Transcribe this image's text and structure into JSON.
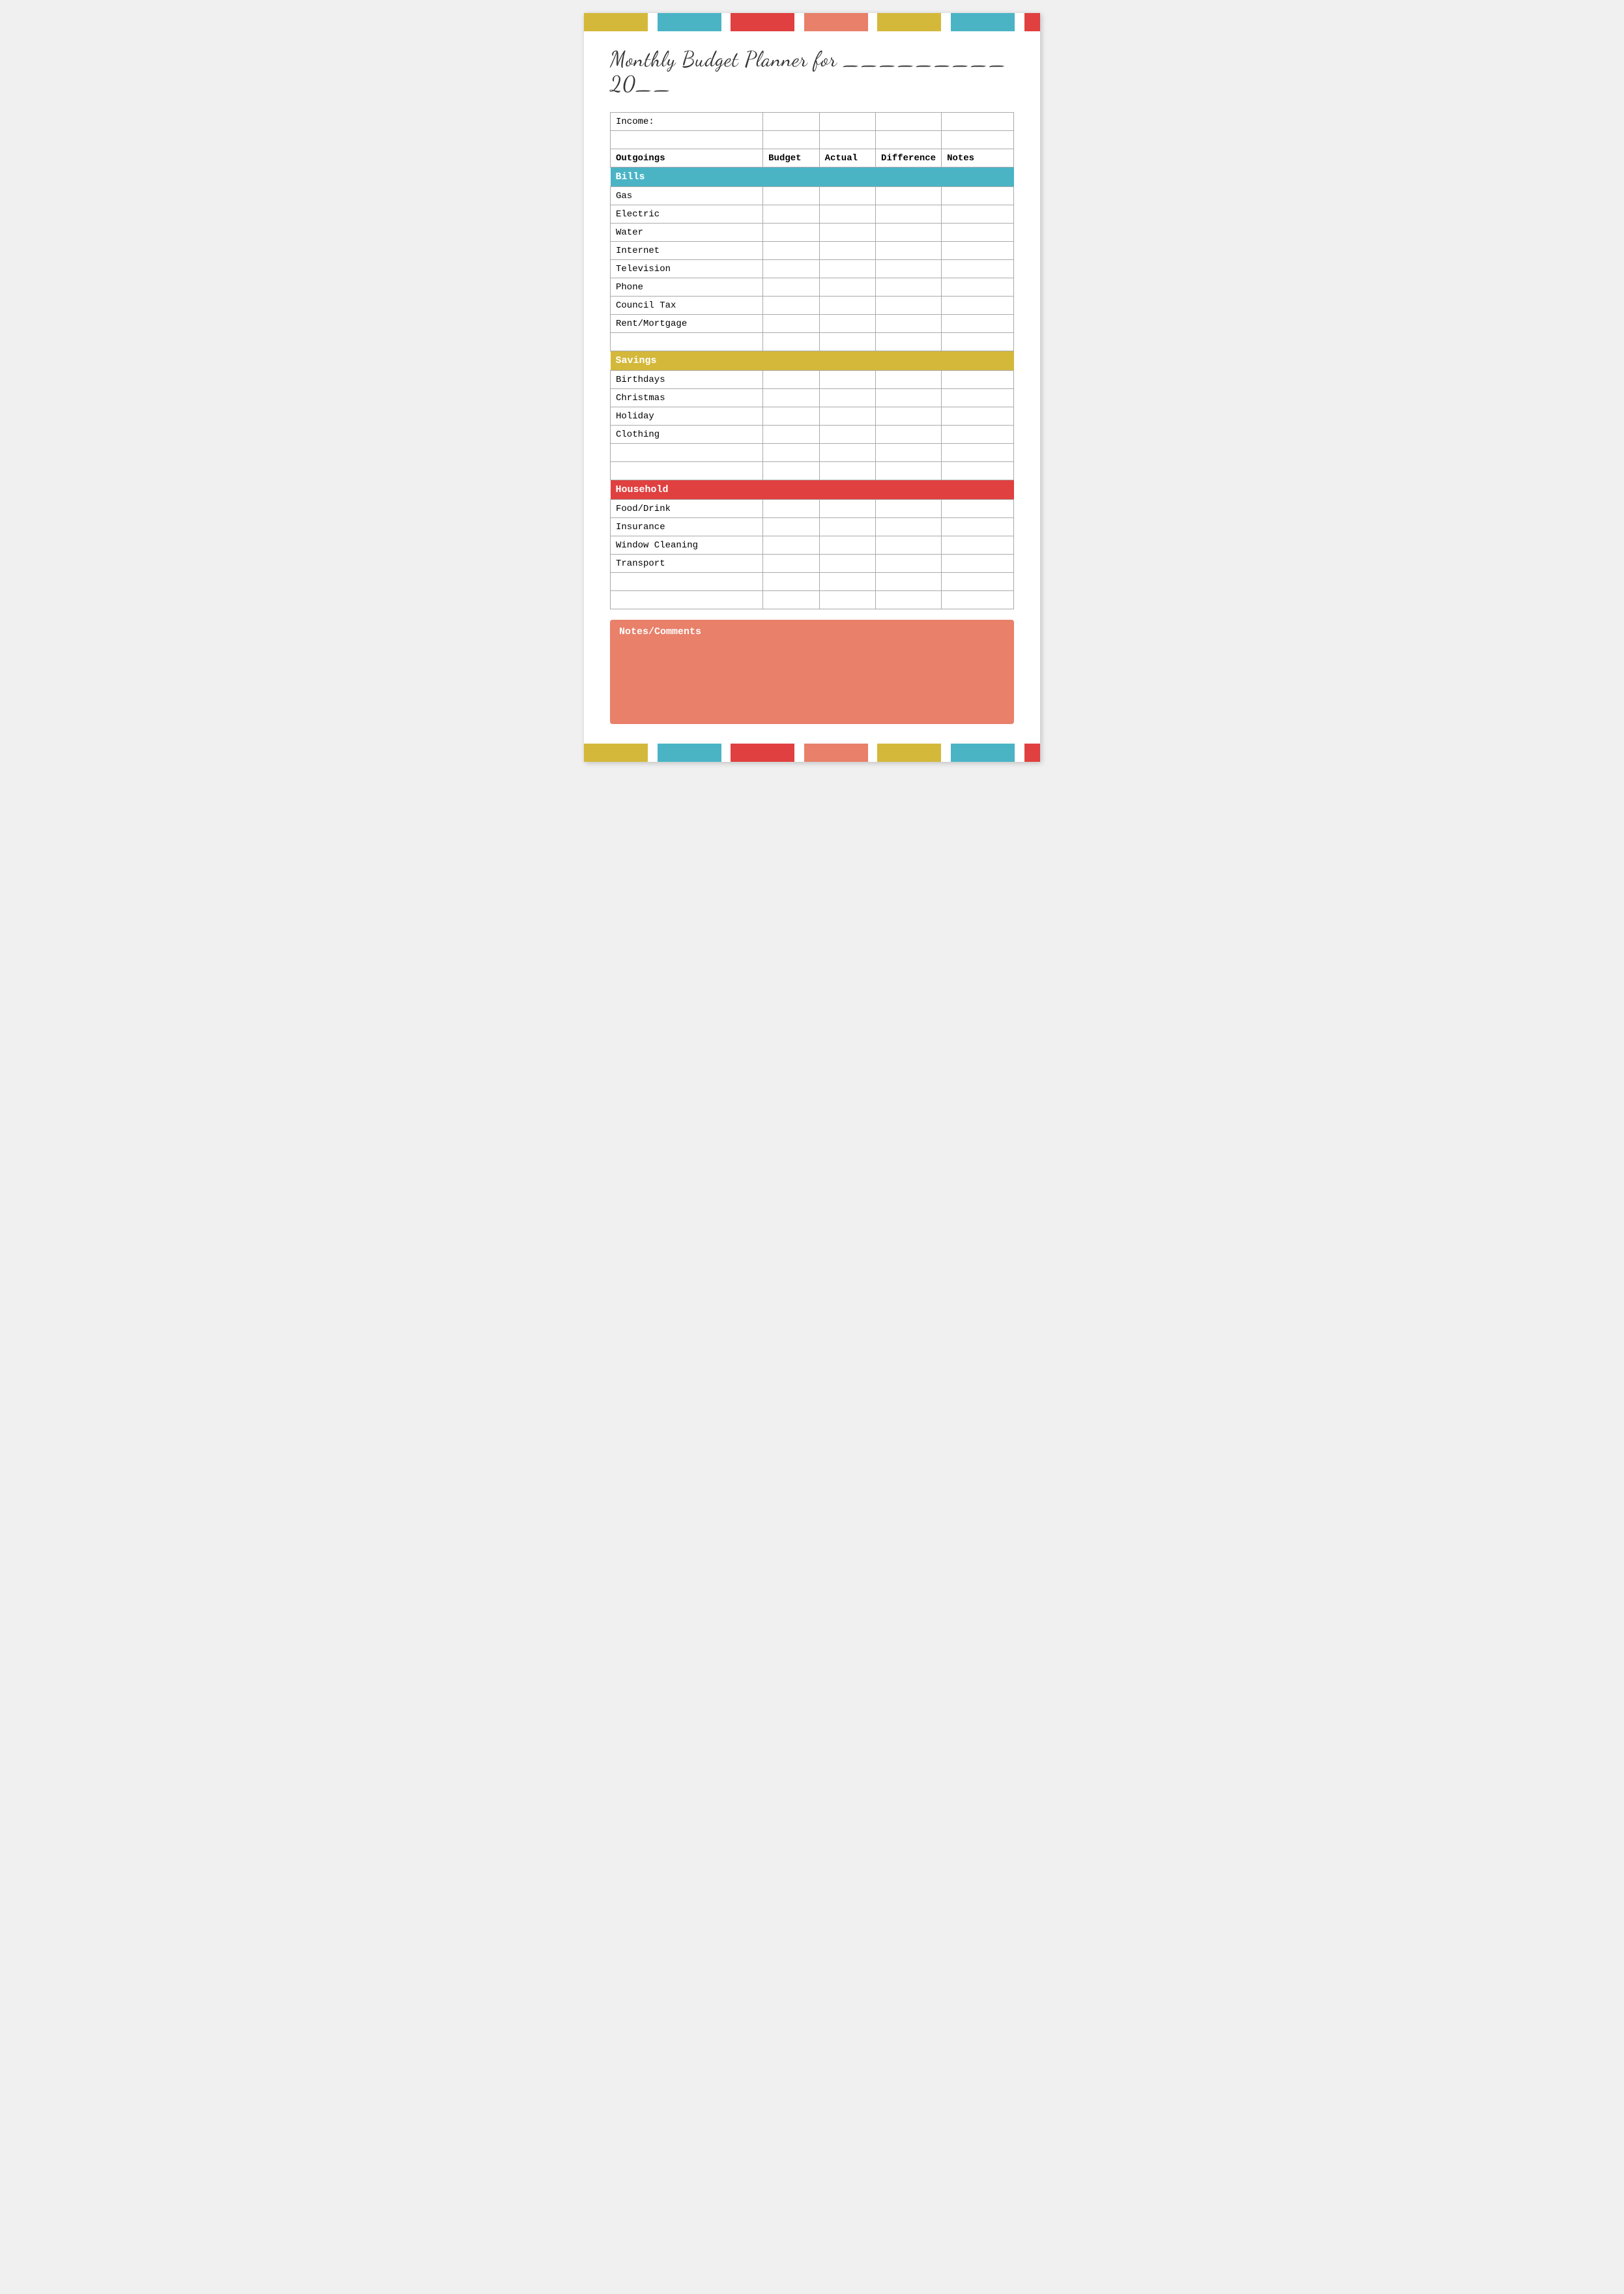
{
  "topBar": {
    "segments": [
      {
        "color": "#d4b83a",
        "flex": 2
      },
      {
        "color": "#ffffff",
        "flex": 0.3
      },
      {
        "color": "#4ab4c5",
        "flex": 2
      },
      {
        "color": "#ffffff",
        "flex": 0.3
      },
      {
        "color": "#e04040",
        "flex": 2
      },
      {
        "color": "#ffffff",
        "flex": 0.3
      },
      {
        "color": "#e8806a",
        "flex": 2
      },
      {
        "color": "#ffffff",
        "flex": 0.3
      },
      {
        "color": "#d4b83a",
        "flex": 2
      },
      {
        "color": "#ffffff",
        "flex": 0.3
      },
      {
        "color": "#4ab4c5",
        "flex": 2
      },
      {
        "color": "#ffffff",
        "flex": 0.3
      },
      {
        "color": "#e04040",
        "flex": 0.5
      }
    ]
  },
  "title": "Monthly Budget Planner for _________ 20__",
  "table": {
    "income_label": "Income:",
    "headers": {
      "outgoings": "Outgoings",
      "budget": "Budget",
      "actual": "Actual",
      "difference": "Difference",
      "notes": "Notes"
    },
    "categories": [
      {
        "name": "Bills",
        "color": "cat-bills",
        "items": [
          "Gas",
          "Electric",
          "Water",
          "Internet",
          "Television",
          "Phone",
          "Council Tax",
          "Rent/Mortgage"
        ]
      },
      {
        "name": "Savings",
        "color": "cat-savings",
        "items": [
          "Birthdays",
          "Christmas",
          "Holiday",
          "Clothing"
        ]
      },
      {
        "name": "Household",
        "color": "cat-household",
        "items": [
          "Food/Drink",
          "Insurance",
          "Window Cleaning",
          "Transport"
        ]
      }
    ]
  },
  "notes": {
    "title": "Notes/Comments"
  }
}
